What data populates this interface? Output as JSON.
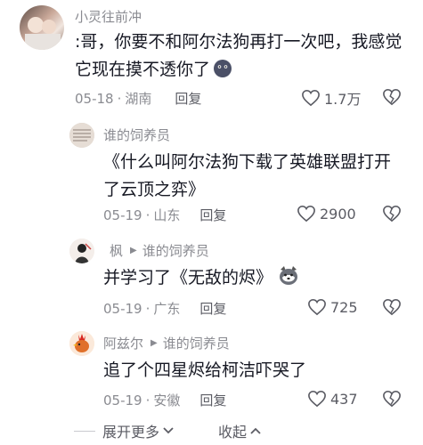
{
  "comments": [
    {
      "username": "小灵往前冲",
      "text_line1": ":哥，你要不和阿尔法狗再打一次吧，我感觉",
      "text_line2": "它现在摸不透你了",
      "date": "05-18",
      "location": "湖南",
      "reply_label": "回复",
      "likes": "1.7万"
    },
    {
      "username": "谁的饲养员",
      "text_line1": "《什么叫阿尔法狗下载了英雄联盟打开",
      "text_line2": "了云顶之弈》",
      "date": "05-19",
      "location": "山东",
      "reply_label": "回复",
      "likes": "2900"
    },
    {
      "username": "枫",
      "reply_to": "谁的饲养员",
      "text_line1": "并学习了《无敌的烬》",
      "date": "05-19",
      "location": "广东",
      "reply_label": "回复",
      "likes": "725"
    },
    {
      "username": "阿兹尔",
      "reply_to": "谁的饲养员",
      "text_line1": "追了个四星烬给柯洁吓哭了",
      "date": "05-19",
      "location": "安徽",
      "reply_label": "回复",
      "likes": "437"
    }
  ],
  "footer": {
    "expand_label": "展开更多",
    "collapse_label": "收起"
  },
  "colors": {
    "meta": "#8a8b91",
    "text": "#161823",
    "action": "#5b5c64"
  }
}
